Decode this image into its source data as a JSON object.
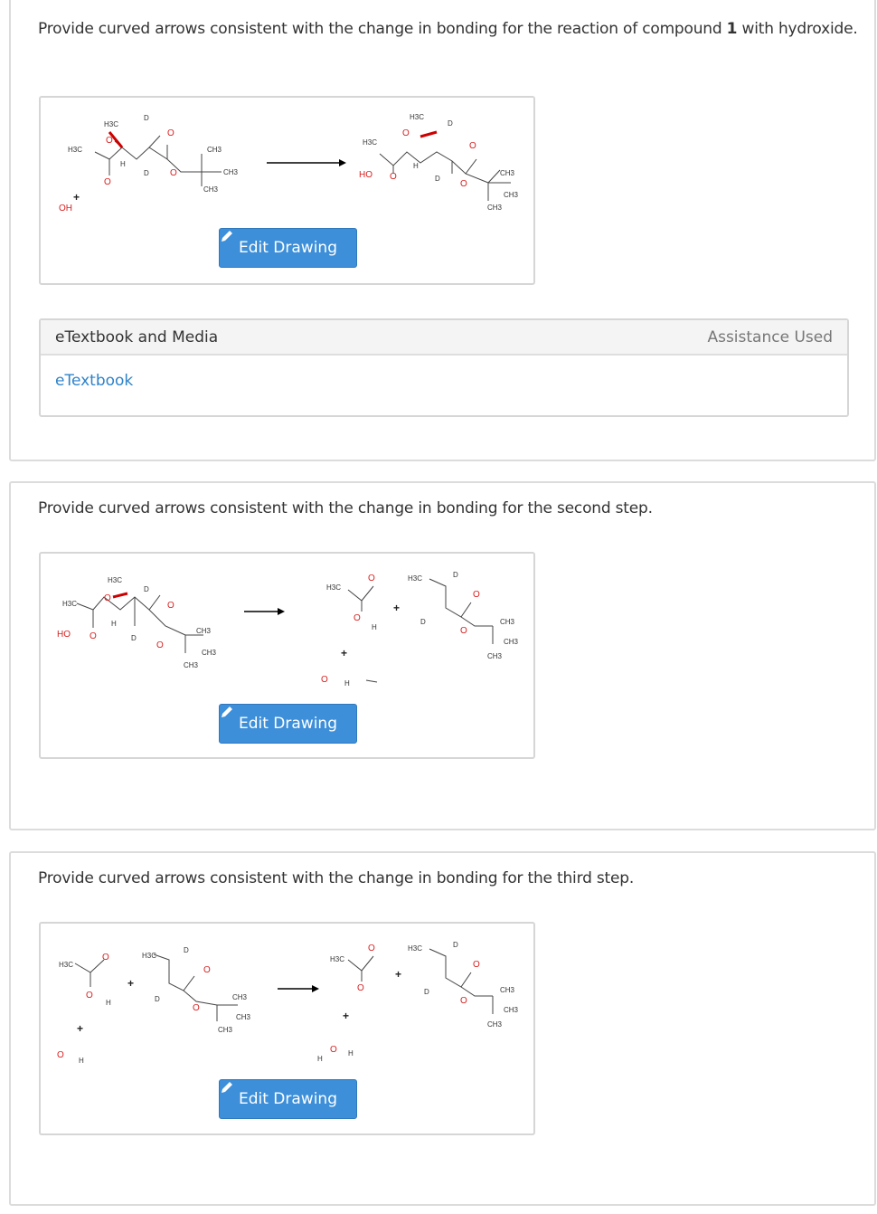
{
  "questions": [
    {
      "prompt_before": "Provide curved arrows consistent with the change in bonding for the reaction of compound ",
      "prompt_bold": "1",
      "prompt_after": " with hydroxide.",
      "edit_label": "Edit Drawing"
    },
    {
      "prompt": "Provide curved arrows consistent with the change in bonding for the second step.",
      "edit_label": "Edit Drawing"
    },
    {
      "prompt": "Provide curved arrows consistent with the change in bonding for the third step.",
      "edit_label": "Edit Drawing"
    }
  ],
  "resources": {
    "title": "eTextbook and Media",
    "status": "Assistance Used",
    "link": "eTextbook"
  },
  "icons": {
    "edit": "pencil-icon",
    "reaction": "reaction-arrow-icon"
  },
  "colors": {
    "button": "#3d8fd9",
    "link": "#2e83c9",
    "oxygen": "#d82020"
  },
  "chem_labels": {
    "h3c": "H3C",
    "ch3": "CH3",
    "d": "D",
    "h": "H",
    "o": "O",
    "ho": "HO",
    "oh": "OH",
    "plus": "+"
  }
}
